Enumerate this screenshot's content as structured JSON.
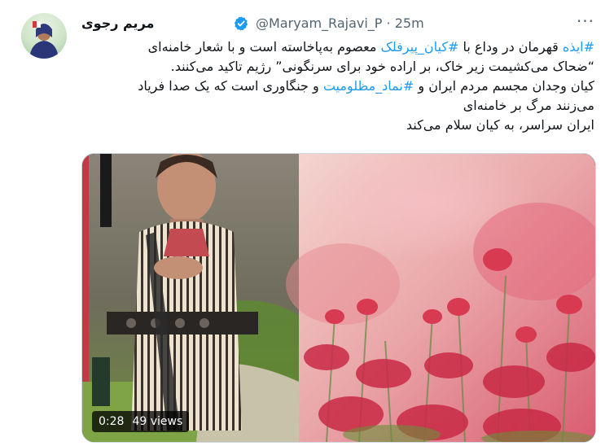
{
  "author": {
    "display_name": "مریم رجوی",
    "handle": "@Maryam_Rajavi_P",
    "separator": "·",
    "time": "25m"
  },
  "actions": {
    "more_label": "···"
  },
  "text": {
    "line1": {
      "tag1": "#ایذه",
      "p1": " قهرمان در وداع با ",
      "tag2": "#کیان_پیرفلک",
      "p2": " معصوم به‌پاخاسته است و با شعار خامنه‌ای"
    },
    "line2": "“ضحاک می‌کشیمت زیر خاک، بر اراده خود برای سرنگونی” رژیم تاکید می‌کنند.",
    "line3": {
      "p1": "کیان وجدان مجسم مردم ایران و ",
      "tag": "#نماد_مظلومیت",
      "p2": " و جنگاوری است که یک صدا فریاد"
    },
    "line4": "می‌زنند مرگ بر خامنه‌ای",
    "line5": "ایران سراسر، به کیان سلام می‌کند"
  },
  "video": {
    "duration": "0:28",
    "views": "49 views"
  },
  "colors": {
    "link": "#1d9bf0",
    "verified": "#1d9bf0",
    "secondary_text": "#536471"
  }
}
